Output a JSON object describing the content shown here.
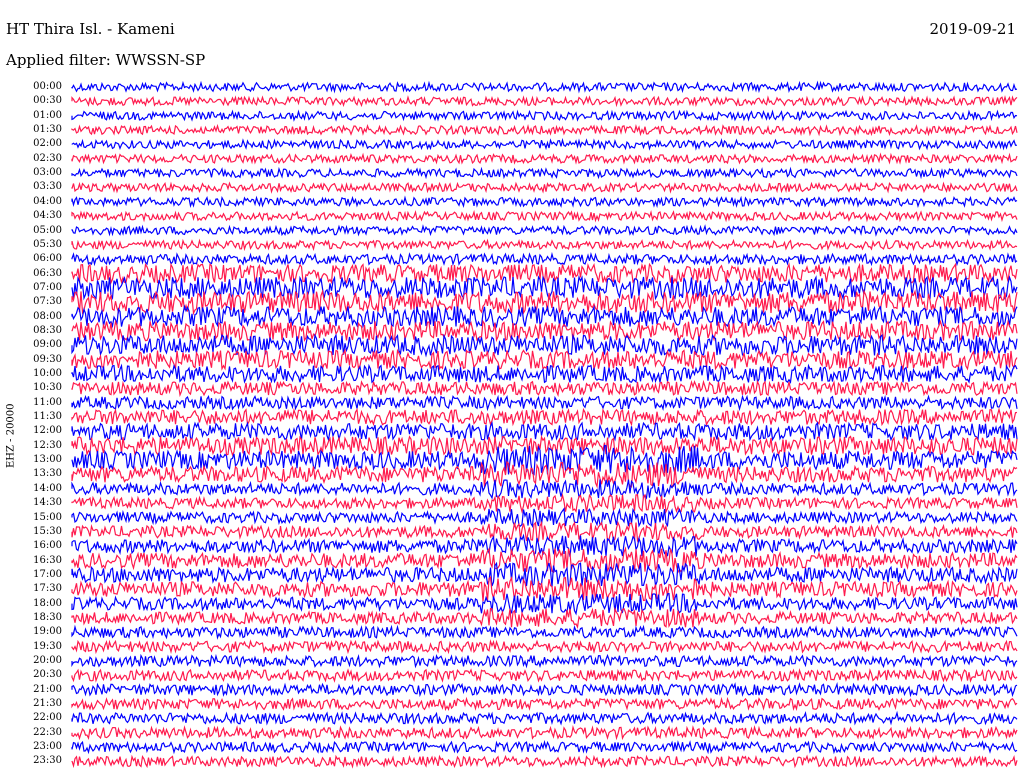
{
  "header": {
    "station": "HT Thira Isl. - Kameni",
    "date": "2019-09-21",
    "filter": "Applied filter: WWSSN-SP"
  },
  "colors": {
    "trace_a": "#0000ff",
    "trace_b": "#ff1a4d",
    "background": "#ffffff"
  },
  "chart_data": {
    "type": "line",
    "subtype": "helicorder",
    "ylabel": "EHZ - 20000",
    "rows": [
      "00:00",
      "00:30",
      "01:00",
      "01:30",
      "02:00",
      "02:30",
      "03:00",
      "03:30",
      "04:00",
      "04:30",
      "05:00",
      "05:30",
      "06:00",
      "06:30",
      "07:00",
      "07:30",
      "08:00",
      "08:30",
      "09:00",
      "09:30",
      "10:00",
      "10:30",
      "11:00",
      "11:30",
      "12:00",
      "12:30",
      "13:00",
      "13:30",
      "14:00",
      "14:30",
      "15:00",
      "15:30",
      "16:00",
      "16:30",
      "17:00",
      "17:30",
      "18:00",
      "18:30",
      "19:00",
      "19:30",
      "20:00",
      "20:30",
      "21:00",
      "21:30",
      "22:00",
      "22:30",
      "23:00",
      "23:30"
    ],
    "trace_colors_alternate": [
      "blue",
      "red"
    ],
    "relative_noise_level": [
      1,
      1,
      1,
      1,
      1,
      1,
      1,
      1,
      1,
      1,
      1,
      1,
      1.2,
      2.2,
      2.6,
      2.6,
      2.4,
      2.3,
      2.4,
      2.2,
      2.0,
      1.6,
      1.5,
      1.8,
      2.0,
      2.2,
      2.2,
      1.9,
      1.4,
      1.3,
      1.3,
      1.4,
      1.6,
      1.8,
      1.8,
      1.8,
      1.5,
      1.4,
      1.3,
      1.3,
      1.3,
      1.3,
      1.3,
      1.3,
      1.3,
      1.3,
      1.2,
      1.2
    ]
  }
}
